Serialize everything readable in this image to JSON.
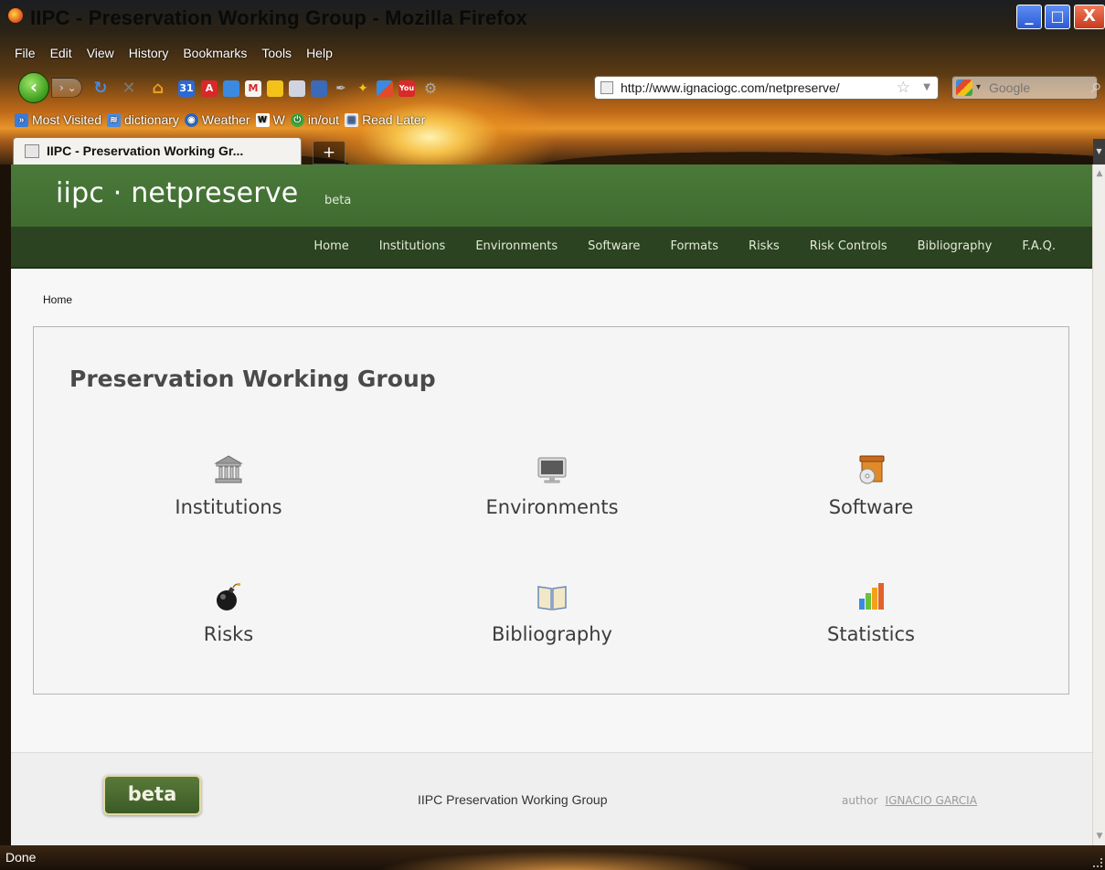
{
  "window": {
    "title": "IIPC - Preservation Working Group - Mozilla Firefox",
    "min_glyph": "_",
    "max_glyph": "□",
    "close_glyph": "X"
  },
  "menu": [
    "File",
    "Edit",
    "View",
    "History",
    "Bookmarks",
    "Tools",
    "Help"
  ],
  "toolbar": {
    "url": "http://www.ignaciogc.com/netpreserve/",
    "search_placeholder": "Google",
    "icons": [
      "reload-icon",
      "stop-icon",
      "home-icon",
      "calendar-icon",
      "acrobat-icon",
      "docs-icon",
      "gmail-icon",
      "notes-icon",
      "reader-icon",
      "rss-icon",
      "pen-icon",
      "wand-icon",
      "google-icon",
      "youtube-icon",
      "gear-icon"
    ]
  },
  "bookmarks": [
    {
      "label": "Most Visited",
      "icon": "most-visited-icon"
    },
    {
      "label": "dictionary",
      "icon": "dictionary-icon"
    },
    {
      "label": "Weather",
      "icon": "weather-icon"
    },
    {
      "label": "W",
      "icon": "wikipedia-icon"
    },
    {
      "label": "in/out",
      "icon": "power-icon"
    },
    {
      "label": "Read Later",
      "icon": "read-later-icon"
    }
  ],
  "tabs": [
    {
      "label": "IIPC - Preservation Working Gr..."
    }
  ],
  "site": {
    "logo": "iipc · netpreserve",
    "logo_tag": "beta",
    "nav": [
      "Home",
      "Institutions",
      "Environments",
      "Software",
      "Formats",
      "Risks",
      "Risk Controls",
      "Bibliography",
      "F.A.Q."
    ],
    "breadcrumb": "Home",
    "panel_title": "Preservation Working Group",
    "tiles": [
      {
        "label": "Institutions",
        "icon": "institution-icon"
      },
      {
        "label": "Environments",
        "icon": "monitor-icon"
      },
      {
        "label": "Software",
        "icon": "software-box-icon"
      },
      {
        "label": "Risks",
        "icon": "bomb-icon"
      },
      {
        "label": "Bibliography",
        "icon": "book-icon"
      },
      {
        "label": "Statistics",
        "icon": "bar-chart-icon"
      }
    ],
    "footer": {
      "badge": "beta",
      "center": "IIPC Preservation Working Group",
      "author_label": "author",
      "author_name": "IGNACIO GARCIA"
    }
  },
  "status": "Done",
  "colors": {
    "header_green": "#4a7a3a",
    "nav_green": "#2b4320",
    "panel_border": "#b5b5b5"
  }
}
